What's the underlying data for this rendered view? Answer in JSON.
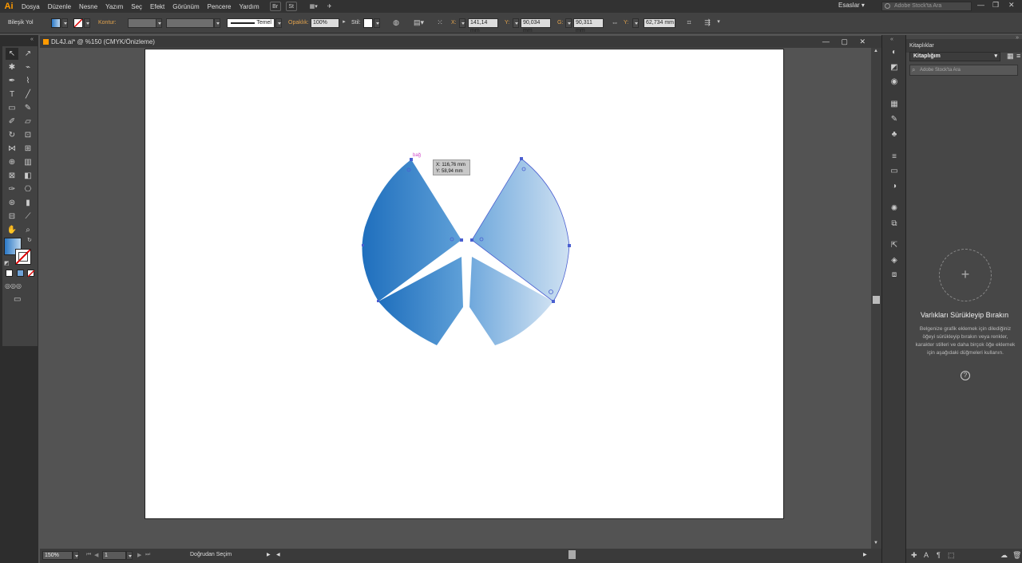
{
  "menubar": {
    "logo": "Ai",
    "items": [
      "Dosya",
      "Düzenle",
      "Nesne",
      "Yazım",
      "Seç",
      "Efekt",
      "Görünüm",
      "Pencere",
      "Yardım"
    ],
    "bridge_btn": "Br",
    "stock_btn": "St",
    "workspace": "Esaslar",
    "search_placeholder": "Adobe Stock'ta Ara"
  },
  "control": {
    "selection_label": "Bileşik Yol",
    "stroke_label": "Kontur:",
    "brush_label": "Temel",
    "opacity_label": "Opaklık:",
    "opacity_value": "100%",
    "style_label": "Stil:",
    "x_label": "X:",
    "x_value": "141,14 mm",
    "y_label": "Y:",
    "y_value": "90,034 mm",
    "w_label": "G:",
    "w_value": "90,311 mm",
    "h_label": "Y:",
    "h_value": "62,734 mm"
  },
  "document": {
    "tab_title": "DL4J.ai* @ %150 (CMYK/Önizleme)"
  },
  "canvas": {
    "anchor_hint": "bağ",
    "tooltip_x": "X: 116,76 mm",
    "tooltip_y": "Y: 58,94 mm"
  },
  "status": {
    "zoom": "150%",
    "artboard_no": "1",
    "tool_name": "Doğrudan Seçim"
  },
  "libraries": {
    "panel_title": "Kitaplıklar",
    "library_name": "Kitaplığım",
    "search_placeholder": "Adobe Stock'ta Ara",
    "drop_title": "Varlıkları Sürükleyip Bırakın",
    "drop_desc": "Belgenize grafik eklemek için dilediğiniz öğeyi sürükleyip bırakın veya renkler, karakter stilleri ve daha birçok öğe eklemek için aşağıdaki düğmeleri kullanın.",
    "help": "?"
  },
  "colors": {
    "gradient_dark": "#1f6fbd",
    "gradient_light": "#c8dcef",
    "selection": "#4a5fd0",
    "orange_label": "#e2a34d"
  }
}
